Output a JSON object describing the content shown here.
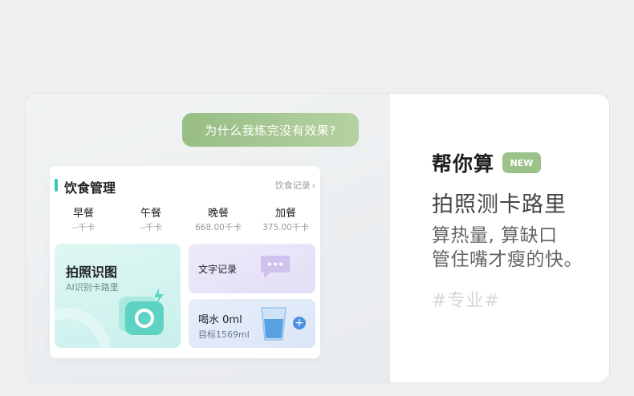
{
  "chat": {
    "question": "为什么我练完没有效果?"
  },
  "diet": {
    "title": "饮食管理",
    "record_link": "饮食记录",
    "meals": [
      {
        "name": "早餐",
        "calories": "--千卡"
      },
      {
        "name": "午餐",
        "calories": "--千卡"
      },
      {
        "name": "晚餐",
        "calories": "668.00千卡"
      },
      {
        "name": "加餐",
        "calories": "375.00千卡"
      }
    ],
    "photo": {
      "title": "拍照识图",
      "subtitle": "AI识别卡路里"
    },
    "text_record": {
      "title": "文字记录"
    },
    "water": {
      "title": "喝水 0ml",
      "target": "目标1569ml"
    }
  },
  "promo": {
    "title": "帮你算",
    "badge": "NEW",
    "subtitle": "拍照测卡路里",
    "desc_line1": "算热量, 算缺口",
    "desc_line2": "管住嘴才瘦的快。",
    "tag": "#专业#"
  },
  "colors": {
    "accent_teal": "#3ac8b6",
    "bubble_green": "#97bd84",
    "badge_green": "#9bc289",
    "water_blue": "#4a90e2"
  },
  "icons": {
    "camera": "camera-icon",
    "chat": "chat-bubble-icon",
    "cup": "water-cup-icon",
    "add": "add-icon",
    "chevron": "chevron-right-icon"
  }
}
